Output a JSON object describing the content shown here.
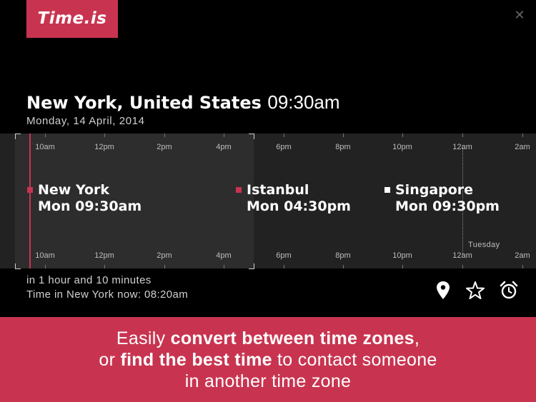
{
  "app": {
    "logo": "Time.is"
  },
  "header": {
    "city": "New York, United States",
    "time": "09:30am",
    "date": "Monday, 14 April, 2014"
  },
  "timeline": {
    "top_ticks": [
      "10am",
      "12pm",
      "2pm",
      "4pm",
      "6pm",
      "8pm",
      "10pm",
      "12am",
      "2am"
    ],
    "bottom_ticks": [
      "10am",
      "12pm",
      "2pm",
      "4pm",
      "6pm",
      "8pm",
      "10pm",
      "12am",
      "2am"
    ],
    "day_label": "Tuesday",
    "zones": [
      {
        "name": "New York",
        "time": "Mon 09:30am",
        "marker_color": "#c83450"
      },
      {
        "name": "Istanbul",
        "time": "Mon 04:30pm",
        "marker_color": "#c83450"
      },
      {
        "name": "Singapore",
        "time": "Mon 09:30pm",
        "marker_color": "#ffffff"
      }
    ]
  },
  "info": {
    "relative": "in 1 hour and 10 minutes",
    "now": "Time in New York now: 08:20am"
  },
  "actions": {
    "location_icon": "map-pin-icon",
    "favorite_icon": "star-icon",
    "alarm_icon": "alarm-clock-icon",
    "close_icon": "close-icon"
  },
  "banner": {
    "l1_a": "Easily ",
    "l1_b": "convert between time zones",
    "l1_c": ",",
    "l2_a": "or ",
    "l2_b": "find the best time",
    "l2_c": " to contact someone",
    "l3": "in another time zone"
  },
  "colors": {
    "accent": "#c83450",
    "background": "#000000",
    "timeline_bg": "#222222"
  }
}
